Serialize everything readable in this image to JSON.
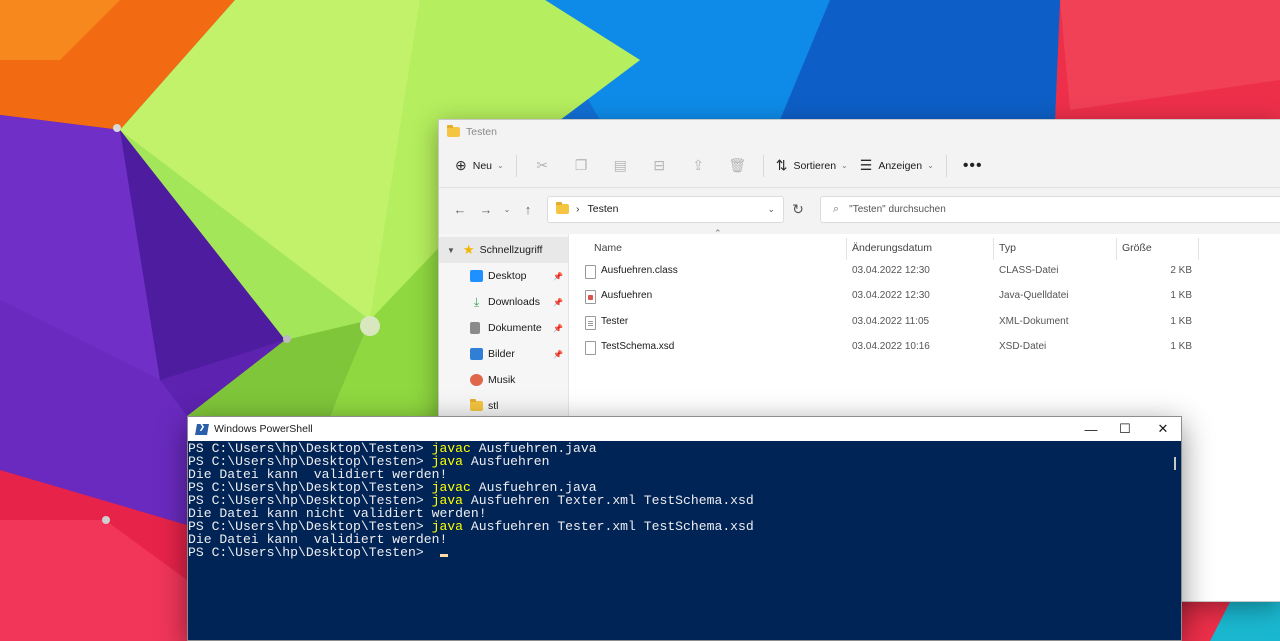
{
  "explorer": {
    "title": "Testen",
    "toolbar": {
      "new_label": "Neu",
      "sort_label": "Sortieren",
      "view_label": "Anzeigen",
      "more_label": "•••"
    },
    "address": {
      "crumb": "Testen",
      "separator": "›"
    },
    "search_placeholder": "\"Testen\" durchsuchen",
    "sidebar": {
      "quick_access": "Schnellzugriff",
      "items": [
        {
          "label": "Desktop",
          "pinned": true,
          "color": "#1e90ff"
        },
        {
          "label": "Downloads",
          "pinned": true,
          "color": "#2ea84a"
        },
        {
          "label": "Dokumente",
          "pinned": true,
          "color": "#7a7a7a"
        },
        {
          "label": "Bilder",
          "pinned": true,
          "color": "#2f7fd6"
        },
        {
          "label": "Musik",
          "pinned": false,
          "color": "#e0664b"
        },
        {
          "label": "stl",
          "pinned": false,
          "color": "#f5c542"
        }
      ]
    },
    "columns": {
      "name": "Name",
      "date": "Änderungsdatum",
      "type": "Typ",
      "size": "Größe"
    },
    "files": [
      {
        "name": "Ausfuehren.class",
        "date": "03.04.2022 12:30",
        "type": "CLASS-Datei",
        "size": "2 KB",
        "icon": "file-icon"
      },
      {
        "name": "Ausfuehren",
        "date": "03.04.2022 12:30",
        "type": "Java-Quelldatei",
        "size": "1 KB",
        "icon": "java-file-icon"
      },
      {
        "name": "Tester",
        "date": "03.04.2022 11:05",
        "type": "XML-Dokument",
        "size": "1 KB",
        "icon": "xml-file-icon"
      },
      {
        "name": "TestSchema.xsd",
        "date": "03.04.2022 10:16",
        "type": "XSD-Datei",
        "size": "1 KB",
        "icon": "file-icon"
      }
    ]
  },
  "powershell": {
    "title": "Windows PowerShell",
    "background": "#012456",
    "command_color": "#ffff00",
    "lines": [
      {
        "prompt": "PS C:\\Users\\hp\\Desktop\\Testen> ",
        "cmd": "javac",
        "rest": " Ausfuehren.java"
      },
      {
        "prompt": "PS C:\\Users\\hp\\Desktop\\Testen> ",
        "cmd": "java",
        "rest": " Ausfuehren"
      },
      {
        "prompt": "Die Datei kann  validiert werden!",
        "cmd": "",
        "rest": ""
      },
      {
        "prompt": "PS C:\\Users\\hp\\Desktop\\Testen> ",
        "cmd": "javac",
        "rest": " Ausfuehren.java"
      },
      {
        "prompt": "PS C:\\Users\\hp\\Desktop\\Testen> ",
        "cmd": "java",
        "rest": " Ausfuehren Texter.xml TestSchema.xsd"
      },
      {
        "prompt": "Die Datei kann nicht validiert werden!",
        "cmd": "",
        "rest": ""
      },
      {
        "prompt": "PS C:\\Users\\hp\\Desktop\\Testen> ",
        "cmd": "java",
        "rest": " Ausfuehren Tester.xml TestSchema.xsd"
      },
      {
        "prompt": "Die Datei kann  validiert werden!",
        "cmd": "",
        "rest": ""
      },
      {
        "prompt": "PS C:\\Users\\hp\\Desktop\\Testen> ",
        "cmd": "",
        "rest": ""
      }
    ]
  }
}
